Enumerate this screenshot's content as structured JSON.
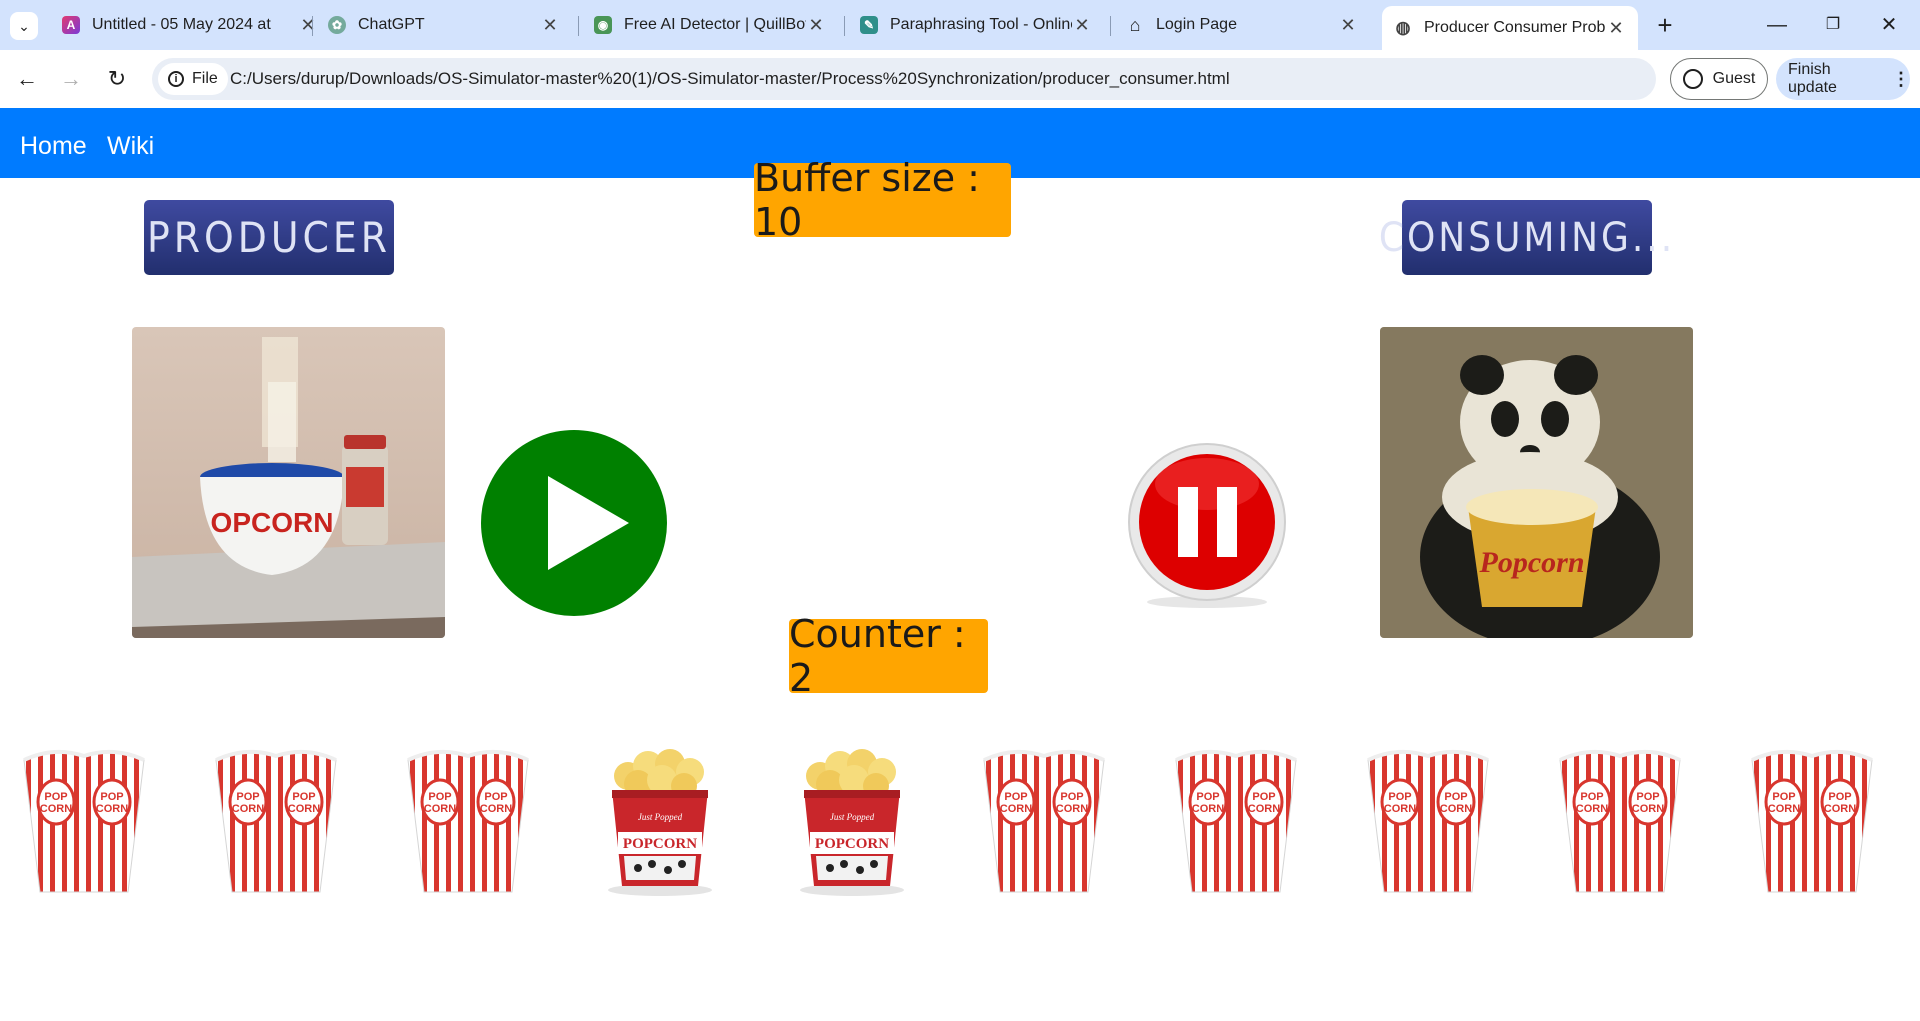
{
  "browser": {
    "tabs": [
      {
        "title": "Untitled - 05 May 2024 at",
        "active": false
      },
      {
        "title": "ChatGPT",
        "active": false
      },
      {
        "title": "Free AI Detector | QuillBot",
        "active": false
      },
      {
        "title": "Paraphrasing Tool - Online",
        "active": false
      },
      {
        "title": "Login Page",
        "active": false
      },
      {
        "title": "Producer Consumer Proble",
        "active": true
      }
    ],
    "site_chip": "File",
    "url": "C:/Users/durup/Downloads/OS-Simulator-master%20(1)/OS-Simulator-master/Process%20Synchronization/producer_consumer.html",
    "profile": "Guest",
    "update_button": "Finish update"
  },
  "navbar": {
    "links": [
      "Home",
      "Wiki"
    ],
    "color": "#007bff"
  },
  "main": {
    "producer_label": "PRODUCER",
    "consumer_label": "CONSUMING...",
    "buffer_label": "Buffer size : 10",
    "counter_label": "Counter : 2",
    "producer_state": "play",
    "consumer_state": "pause",
    "buffer_slots": [
      "empty",
      "empty",
      "empty",
      "full",
      "full",
      "empty",
      "empty",
      "empty",
      "empty",
      "empty"
    ],
    "accent_color": "#ffa500"
  }
}
